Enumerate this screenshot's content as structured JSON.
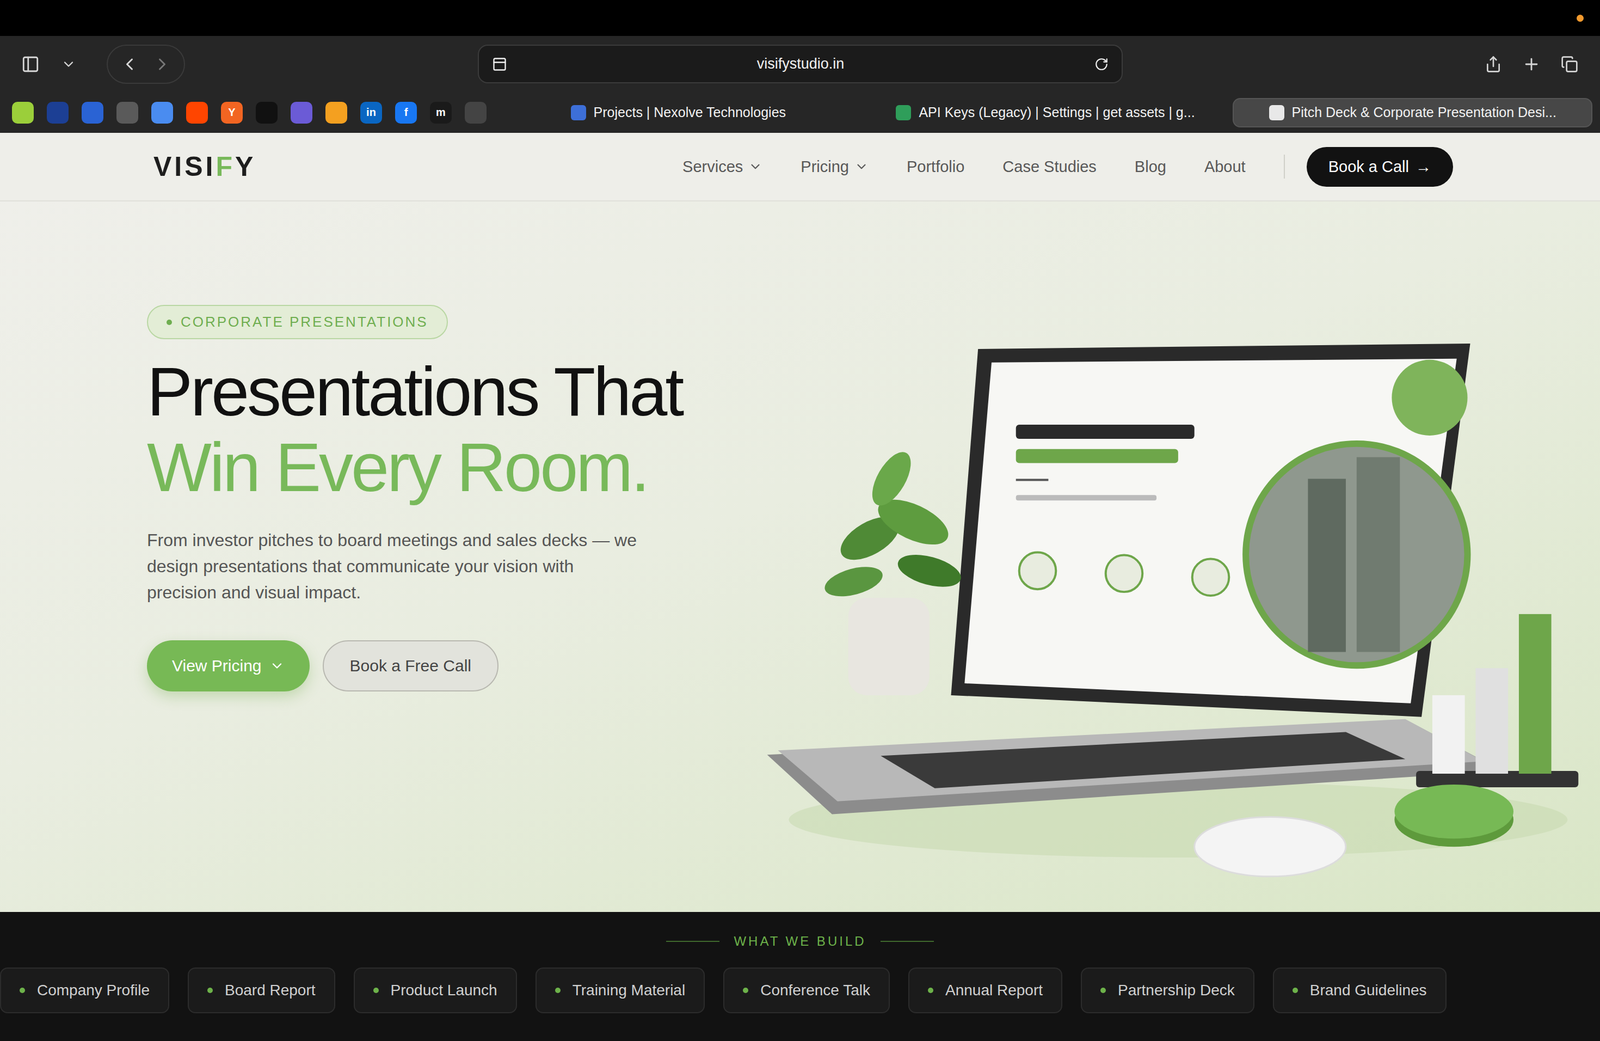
{
  "browser": {
    "url": "visifystudio.in",
    "bookmarks": [
      {
        "color": "#9bcf3a"
      },
      {
        "color": "#1c3f94"
      },
      {
        "color": "#2a63d4"
      },
      {
        "color": "#5a5a5a"
      },
      {
        "color": "#4a8cf0"
      },
      {
        "color": "#ff4500"
      },
      {
        "color": "#f26522",
        "glyph": "Y"
      },
      {
        "color": "#111111"
      },
      {
        "color": "#6b5bd6"
      },
      {
        "color": "#f4a020"
      },
      {
        "color": "#0a66c2",
        "glyph": "in"
      },
      {
        "color": "#1877f2",
        "glyph": "f"
      },
      {
        "color": "#1a1a1a",
        "glyph": "m"
      },
      {
        "color": "#444444"
      }
    ],
    "tabs": [
      {
        "label": "Projects | Nexolve Technologies",
        "selected": false,
        "color": "#3d6fd8"
      },
      {
        "label": "API Keys (Legacy) | Settings | get assets | g...",
        "selected": false,
        "color": "#2f9e5a"
      },
      {
        "label": "Pitch Deck & Corporate Presentation Desi...",
        "selected": true,
        "color": "#e8e8e8"
      }
    ]
  },
  "nav": {
    "logo": [
      {
        "text": "VISI",
        "accent": false
      },
      {
        "text": "F",
        "accent": true
      },
      {
        "text": "Y",
        "accent": false
      }
    ],
    "links": [
      {
        "label": "Services",
        "dropdown": true
      },
      {
        "label": "Pricing",
        "dropdown": true
      },
      {
        "label": "Portfolio",
        "dropdown": false
      },
      {
        "label": "Case Studies",
        "dropdown": false
      },
      {
        "label": "Blog",
        "dropdown": false
      },
      {
        "label": "About",
        "dropdown": false
      }
    ],
    "cta": {
      "label": "Book a Call",
      "arrow": "→"
    }
  },
  "hero": {
    "badge": "CORPORATE PRESENTATIONS",
    "heading": "Presentations That",
    "heading_accent": "Win Every Room.",
    "lead": "From investor pitches to board meetings and sales decks — we design presentations that communicate your vision with precision and visual impact.",
    "primary_button": "View Pricing",
    "secondary_button": "Book a Free Call"
  },
  "showcase": {
    "label": "WHAT WE BUILD",
    "items": [
      "Company Profile",
      "Board Report",
      "Product Launch",
      "Training Material",
      "Conference Talk",
      "Annual Report",
      "Partnership Deck",
      "Brand Guidelines"
    ]
  }
}
